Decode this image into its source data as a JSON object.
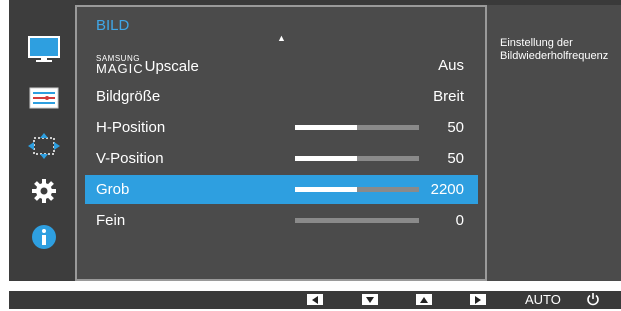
{
  "menu": {
    "title": "BILD",
    "rows": [
      {
        "label_prefix_small": "SAMSUNG",
        "label_prefix_big": "MAGIC",
        "label": "Upscale",
        "value": "Aus"
      },
      {
        "label": "Bildgröße",
        "value": "Breit"
      },
      {
        "label": "H-Position",
        "value": "50",
        "slider_fraction": 0.5
      },
      {
        "label": "V-Position",
        "value": "50",
        "slider_fraction": 0.5
      },
      {
        "label": "Grob",
        "value": "2200",
        "slider_fraction": 0.5,
        "selected": true
      },
      {
        "label": "Fein",
        "value": "0",
        "slider_fraction": 0.0
      }
    ]
  },
  "info": {
    "text": "Einstellung der\nBildwiederholfrequenz"
  },
  "sidebar": {
    "icons": [
      "monitor-icon",
      "settings-list-icon",
      "resize-icon",
      "gear-icon",
      "info-icon"
    ]
  },
  "bottom_bar": {
    "keys": [
      "left-arrow-key",
      "down-arrow-key",
      "up-arrow-key",
      "right-arrow-key"
    ],
    "auto_label": "AUTO"
  },
  "colors": {
    "accent": "#2e9fe0",
    "title": "#3fa7e8"
  }
}
